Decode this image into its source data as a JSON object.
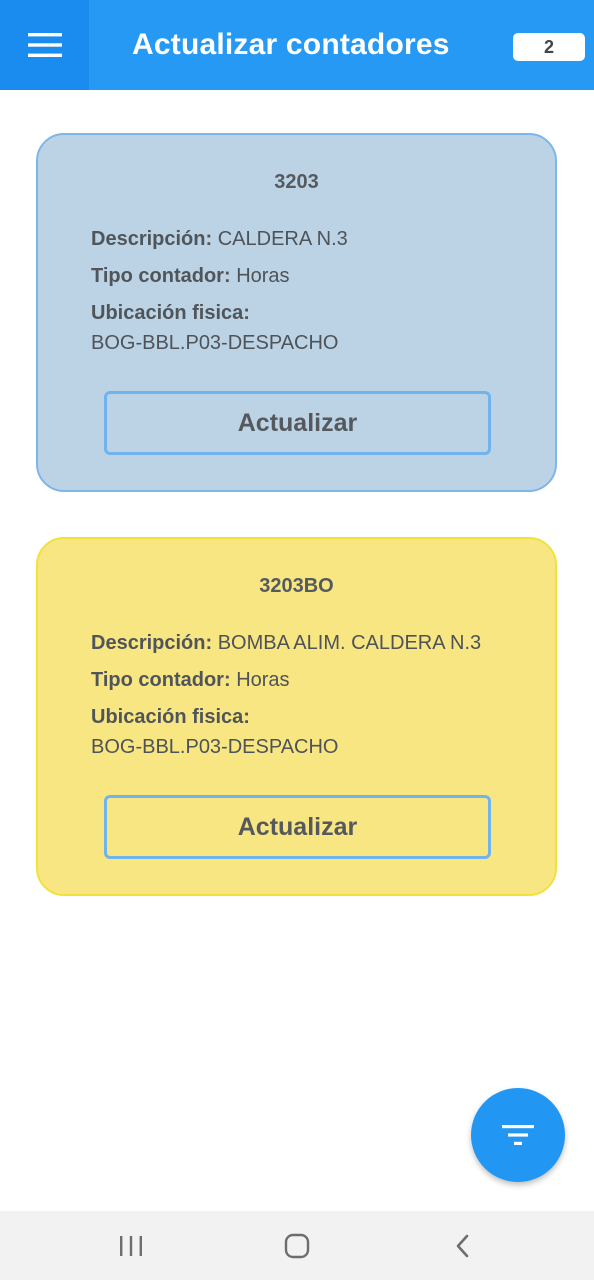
{
  "header": {
    "title": "Actualizar contadores",
    "count": "2"
  },
  "cards": [
    {
      "code": "3203",
      "description_label": "Descripción:",
      "description_value": "CALDERA N.3",
      "type_label": "Tipo contador:",
      "type_value": "Horas",
      "location_label": "Ubicación fisica:",
      "location_value": "BOG-BBL.P03-DESPACHO",
      "button_label": "Actualizar",
      "bg_color": "#bcd3e6"
    },
    {
      "code": "3203BO",
      "description_label": "Descripción:",
      "description_value": "BOMBA ALIM. CALDERA N.3",
      "type_label": "Tipo contador:",
      "type_value": "Horas",
      "location_label": "Ubicación fisica:",
      "location_value": "BOG-BBL.P03-DESPACHO",
      "button_label": "Actualizar",
      "bg_color": "#f8e683"
    }
  ],
  "icons": {
    "menu": "hamburger-menu-icon",
    "filter": "filter-icon",
    "recents": "recent-apps-icon",
    "home": "home-icon",
    "back": "back-icon"
  },
  "colors": {
    "primary": "#2699f5",
    "fab": "#2196f3"
  }
}
